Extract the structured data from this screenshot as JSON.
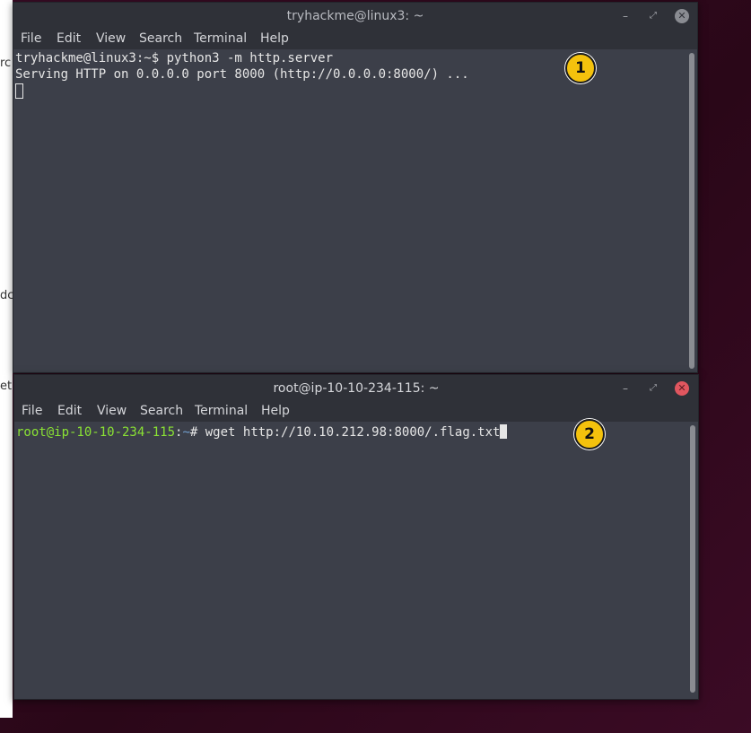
{
  "desktop": {
    "fragments": [
      "rc",
      "dc",
      "et"
    ]
  },
  "window1": {
    "title": "tryhackme@linux3: ~",
    "controls": {
      "minimize": "–",
      "maximize": "⤢",
      "close": "✕"
    },
    "menu": [
      "File",
      "Edit",
      "View",
      "Search",
      "Terminal",
      "Help"
    ],
    "lines": [
      "tryhackme@linux3:~$ python3 -m http.server",
      "Serving HTTP on 0.0.0.0 port 8000 (http://0.0.0.0:8000/) ..."
    ],
    "badge": "1"
  },
  "window2": {
    "title": "root@ip-10-10-234-115: ~",
    "controls": {
      "minimize": "–",
      "maximize": "⤢",
      "close": "✕"
    },
    "menu": [
      "File",
      "Edit",
      "View",
      "Search",
      "Terminal",
      "Help"
    ],
    "prompt_user": "root@ip-10-10-234-115",
    "prompt_sep": ":",
    "prompt_path": "~",
    "prompt_symbol": "# ",
    "command": "wget http://10.10.212.98:8000/.flag.txt",
    "badge": "2"
  },
  "colors": {
    "terminal_bg": "#3c3f49",
    "titlebar_bg": "#2f3138",
    "prompt_user": "#8ae234",
    "badge": "#f4c20d",
    "close_active": "#e0565f"
  }
}
